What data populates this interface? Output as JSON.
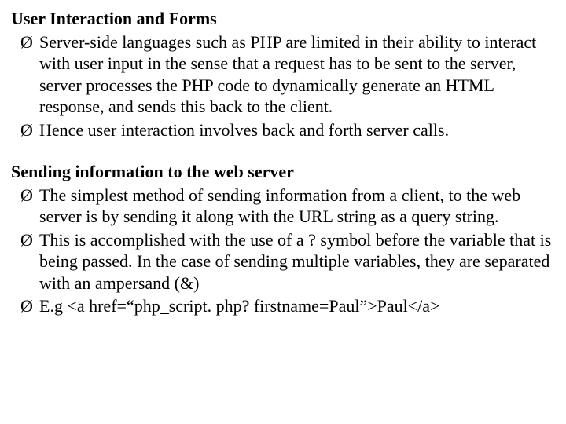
{
  "bullet_glyph": "Ø",
  "section1": {
    "heading": "User Interaction and Forms",
    "items": [
      "Server-side languages such as PHP are limited in their ability to interact with user input in the sense that a request has to be sent to the server, server processes the PHP code to dynamically generate an HTML response, and sends this back to the client.",
      "Hence user interaction involves back and forth server calls."
    ]
  },
  "section2": {
    "heading": "Sending information to the web server",
    "items": [
      "The simplest method of sending information from a client, to the web server is by sending it along with the URL string as a query string.",
      "This is accomplished with the use of a ? symbol before the variable that is being passed. In the case of sending multiple variables, they are separated with an ampersand (&)",
      "E.g <a href=“php_script. php? firstname=Paul”>Paul</a>"
    ]
  }
}
